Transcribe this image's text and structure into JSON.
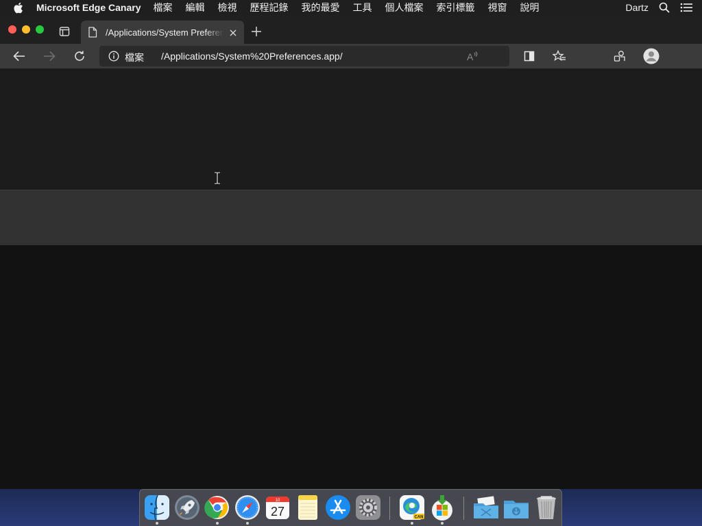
{
  "menubar": {
    "app_name": "Microsoft Edge Canary",
    "items": [
      "檔案",
      "編輯",
      "檢視",
      "歷程記錄",
      "我的最愛",
      "工具",
      "個人檔案",
      "索引標籤",
      "視窗",
      "說明"
    ],
    "user": "Dartz"
  },
  "tab": {
    "title": "/Applications/System Preferences.app/"
  },
  "address": {
    "scheme_label": "檔案",
    "url": "/Applications/System%20Preferences.app/"
  },
  "colors": {
    "menubar_bg": "#1f1f1f",
    "tabstrip_bg": "#202020",
    "toolbar_bg": "#3b3b3b",
    "page_bg": "#121212"
  },
  "dock": {
    "apps": [
      "finder-icon",
      "launchpad-icon",
      "chrome-icon",
      "safari-icon",
      "calendar-icon",
      "notes-icon",
      "app-store-icon",
      "system-preferences-icon",
      "edge-canary-icon",
      "installer-icon",
      "mail-folder-icon",
      "downloads-folder-icon",
      "trash-icon"
    ],
    "calendar_month": "10",
    "calendar_day": "27",
    "edge_badge": "CAN"
  }
}
